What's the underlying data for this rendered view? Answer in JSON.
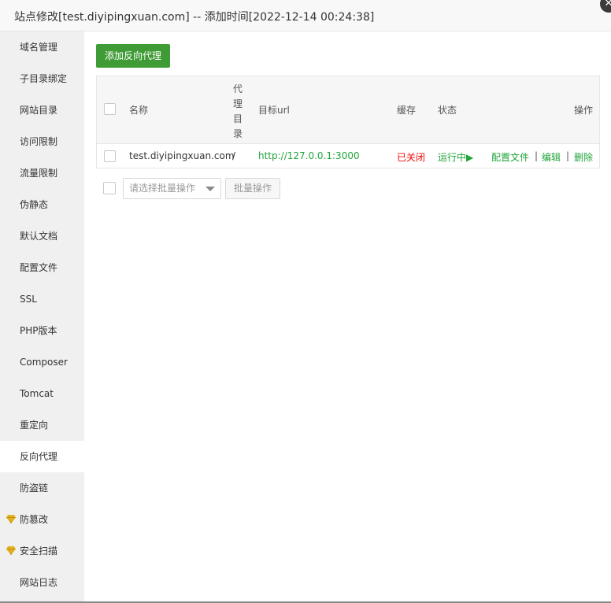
{
  "window": {
    "title": "站点修改[test.diyipingxuan.com] -- 添加时间[2022-12-14 00:24:38]",
    "close_label": "✕"
  },
  "sidebar": {
    "items": [
      {
        "label": "域名管理"
      },
      {
        "label": "子目录绑定"
      },
      {
        "label": "网站目录"
      },
      {
        "label": "访问限制"
      },
      {
        "label": "流量限制"
      },
      {
        "label": "伪静态"
      },
      {
        "label": "默认文档"
      },
      {
        "label": "配置文件"
      },
      {
        "label": "SSL"
      },
      {
        "label": "PHP版本"
      },
      {
        "label": "Composer"
      },
      {
        "label": "Tomcat"
      },
      {
        "label": "重定向"
      },
      {
        "label": "反向代理",
        "active": true
      },
      {
        "label": "防盗链"
      },
      {
        "label": "防篡改",
        "icon": "gem-icon"
      },
      {
        "label": "安全扫描",
        "icon": "gem-icon"
      },
      {
        "label": "网站日志"
      }
    ]
  },
  "toolbar": {
    "add_label": "添加反向代理"
  },
  "table": {
    "headers": {
      "name": "名称",
      "proxy_dir": [
        "代",
        "理",
        "目",
        "录"
      ],
      "target_url": "目标url",
      "cache": "缓存",
      "status": "状态",
      "actions": "操作"
    },
    "rows": [
      {
        "name": "test.diyipingxuan.com",
        "proxy_dir": "/",
        "target_url": "http://127.0.0.1:3000",
        "cache": "已关闭",
        "status": "运行中▶",
        "action_config": "配置文件",
        "action_edit": "编辑",
        "action_delete": "删除",
        "separator": "|"
      }
    ]
  },
  "batch": {
    "placeholder": "请选择批量操作",
    "button_label": "批量操作"
  },
  "colors": {
    "accent_green": "#20a53a",
    "button_green": "#3f9b35",
    "status_red": "#ef0808",
    "gem_gold": "#e8b923"
  }
}
